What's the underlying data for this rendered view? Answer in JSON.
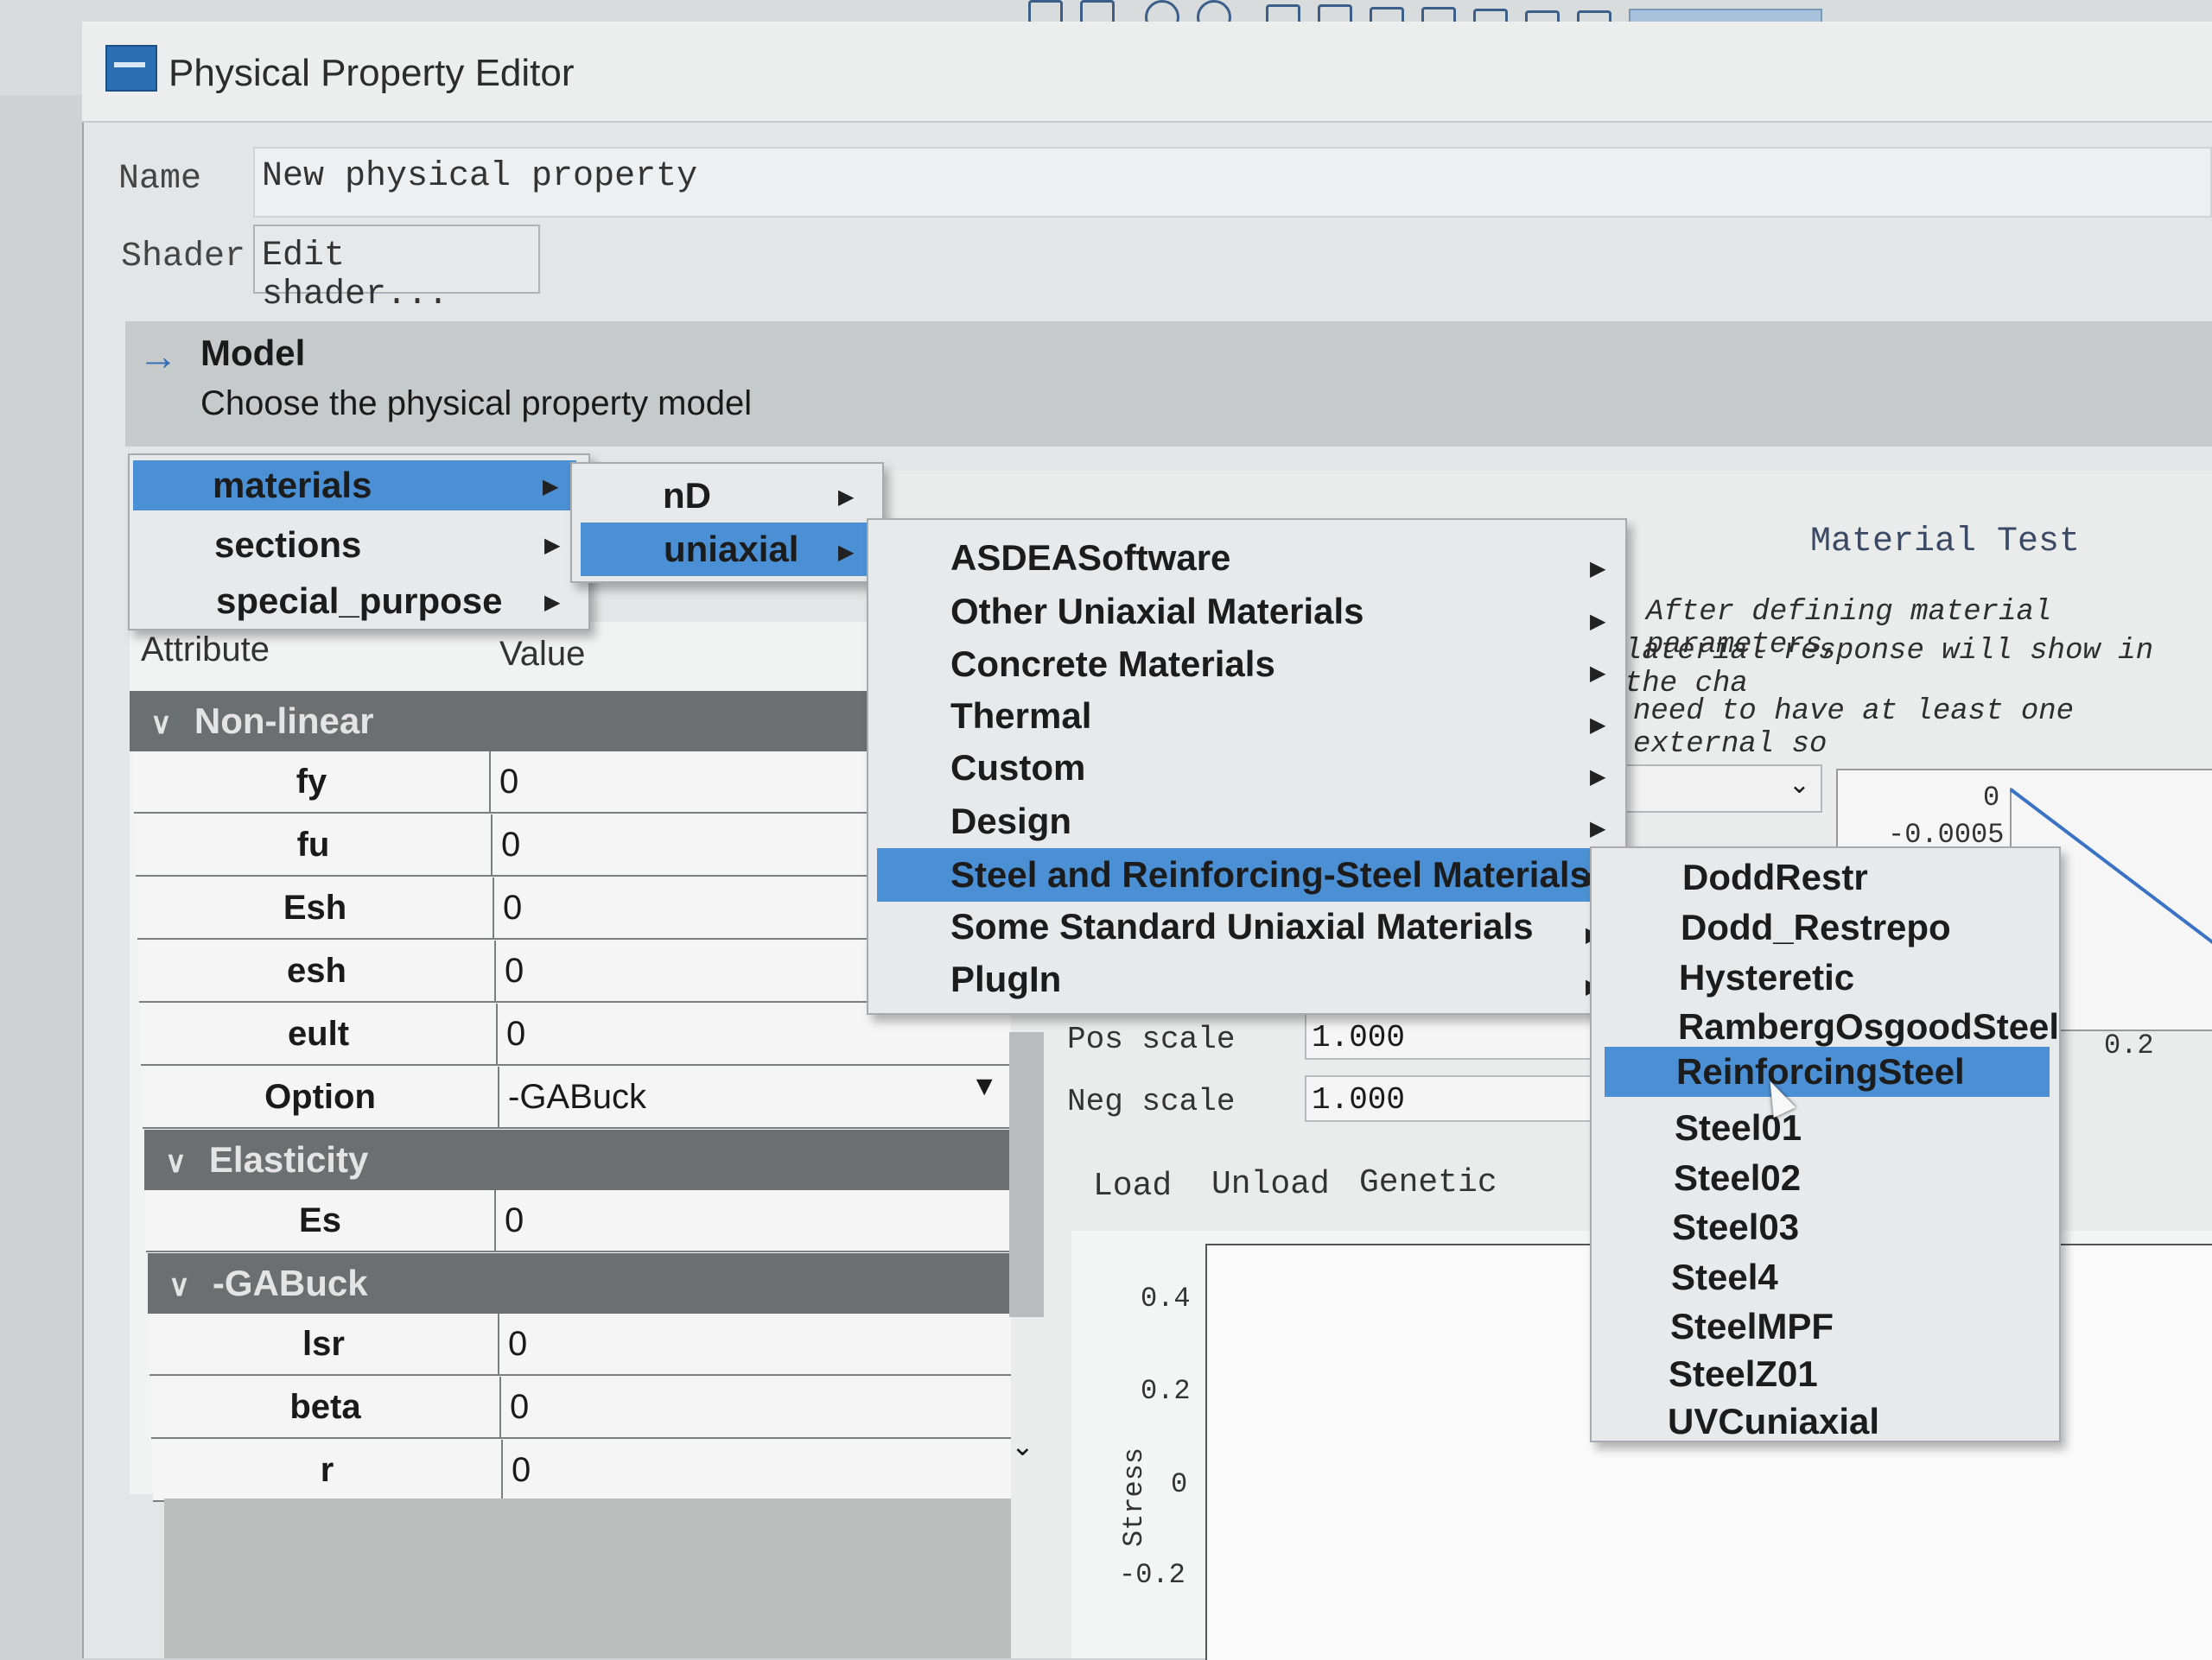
{
  "window": {
    "title": "Physical Property Editor"
  },
  "form": {
    "name_label": "Name",
    "name_value": "New physical property",
    "shader_label": "Shader",
    "shader_button": "Edit shader..."
  },
  "model": {
    "title": "Model",
    "subtitle": "Choose the physical property model"
  },
  "menu_level1": [
    "materials",
    "sections",
    "special_purpose"
  ],
  "menu_level2": [
    "nD",
    "uniaxial"
  ],
  "menu_level3": [
    "ASDEASoftware",
    "Other Uniaxial Materials",
    "Concrete Materials",
    "Thermal",
    "Custom",
    "Design",
    "Steel and Reinforcing-Steel Materials",
    "Some Standard Uniaxial Materials",
    "PlugIn"
  ],
  "menu_level4": [
    "DoddRestr",
    "Dodd_Restrepo",
    "Hysteretic",
    "RambergOsgoodSteel",
    "ReinforcingSteel",
    "Steel01",
    "Steel02",
    "Steel03",
    "Steel4",
    "SteelMPF",
    "SteelZ01",
    "UVCuniaxial"
  ],
  "table": {
    "col_attribute": "Attribute",
    "col_value": "Value",
    "groups": {
      "nonlinear": "Non-linear",
      "elasticity": "Elasticity",
      "gabuck": "-GABuck"
    },
    "rows": {
      "fy": {
        "name": "fy",
        "value": "0"
      },
      "fu": {
        "name": "fu",
        "value": "0"
      },
      "Esh": {
        "name": "Esh",
        "value": "0"
      },
      "esh": {
        "name": "esh",
        "value": "0"
      },
      "eult": {
        "name": "eult",
        "value": "0"
      },
      "option": {
        "name": "Option",
        "value": "-GABuck"
      },
      "Es": {
        "name": "Es",
        "value": "0"
      },
      "lsr": {
        "name": "lsr",
        "value": "0"
      },
      "beta": {
        "name": "beta",
        "value": "0"
      },
      "r": {
        "name": "r",
        "value": "0"
      }
    }
  },
  "test": {
    "title": "Material Test",
    "line1": "After defining material parameters,",
    "line2": "laterial response will show in the cha",
    "line3": "need to have at least one external so",
    "pos_scale_label": "Pos scale",
    "pos_scale_value": "1.000",
    "neg_scale_label": "Neg scale",
    "neg_scale_value": "1.000",
    "tabs": [
      "Load",
      "Unload",
      "Genetic"
    ],
    "mini_ticks": {
      "y0": "0",
      "y1": "-0.0005",
      "x": "0.2"
    },
    "ylabel": "Stress",
    "yticks": [
      "0.4",
      "0.2",
      "0",
      "-0.2"
    ]
  },
  "colors": {
    "selection": "#4b90d4",
    "group_header": "#6c6f70",
    "accent": "#2f6db5"
  }
}
